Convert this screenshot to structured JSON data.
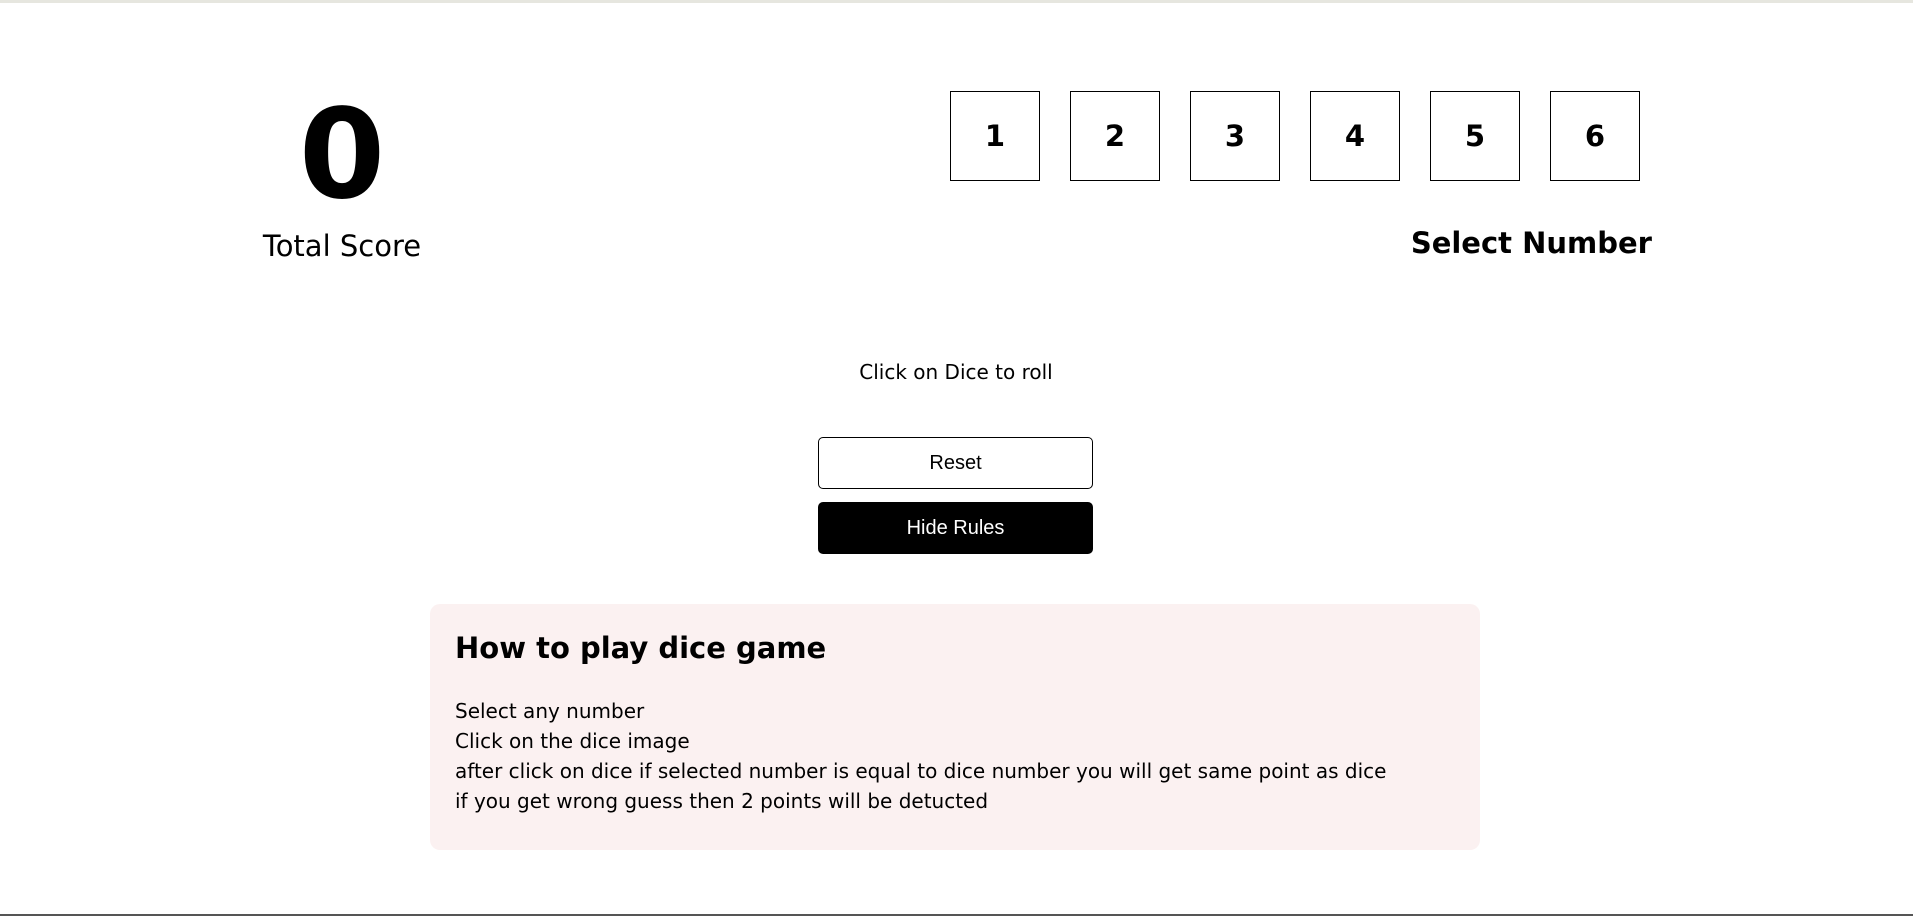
{
  "score": {
    "value": "0",
    "label": "Total Score"
  },
  "number_selector": {
    "options": [
      "1",
      "2",
      "3",
      "4",
      "5",
      "6"
    ],
    "label": "Select Number"
  },
  "dice": {
    "hint": "Click on Dice to roll"
  },
  "buttons": {
    "reset_label": "Reset",
    "rules_label": "Hide Rules"
  },
  "rules": {
    "title": "How to play dice game",
    "lines": [
      "Select any number",
      "Click on the dice image",
      "after click on dice if selected number is equal to dice number you will get same point as dice",
      "if you get wrong guess then 2 points will be detucted"
    ]
  },
  "colors": {
    "rules_background": "#fbf1f1",
    "primary": "#000000",
    "background": "#ffffff"
  }
}
